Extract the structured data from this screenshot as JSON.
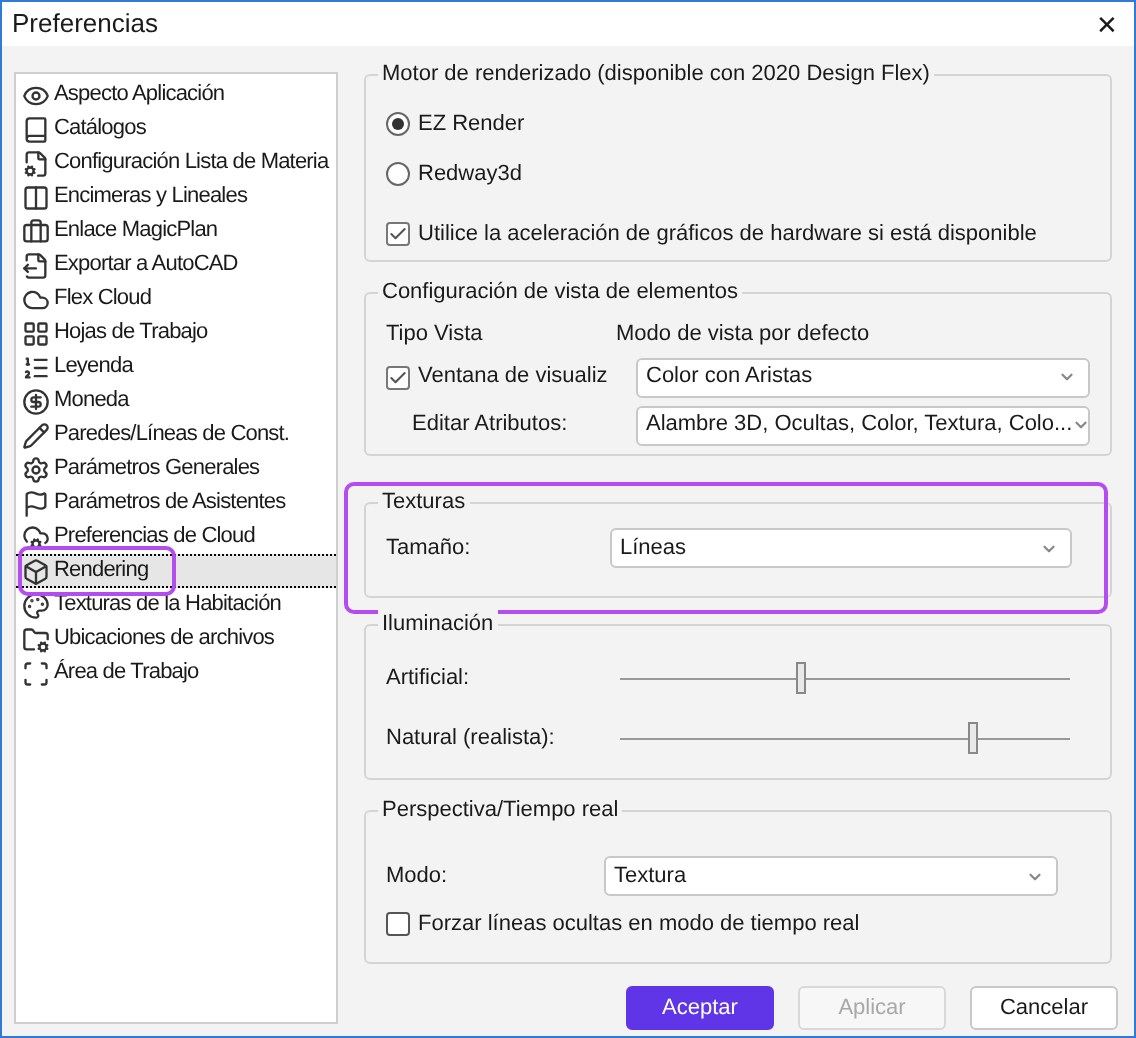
{
  "window": {
    "title": "Preferencias",
    "close": "✕"
  },
  "sidebar": {
    "items": [
      {
        "label": "Aspecto Aplicación",
        "selected": false
      },
      {
        "label": "Catálogos",
        "selected": false
      },
      {
        "label": "Configuración Lista de Materia",
        "selected": false
      },
      {
        "label": "Encimeras y Lineales",
        "selected": false
      },
      {
        "label": "Enlace MagicPlan",
        "selected": false
      },
      {
        "label": "Exportar a AutoCAD",
        "selected": false
      },
      {
        "label": "Flex Cloud",
        "selected": false
      },
      {
        "label": "Hojas de Trabajo",
        "selected": false
      },
      {
        "label": "Leyenda",
        "selected": false
      },
      {
        "label": "Moneda",
        "selected": false
      },
      {
        "label": "Paredes/Líneas de Const.",
        "selected": false
      },
      {
        "label": "Parámetros Generales",
        "selected": false
      },
      {
        "label": "Parámetros de Asistentes",
        "selected": false
      },
      {
        "label": "Preferencias de Cloud",
        "selected": false
      },
      {
        "label": "Rendering",
        "selected": true
      },
      {
        "label": "Texturas de la Habitación",
        "selected": false
      },
      {
        "label": "Ubicaciones de archivos",
        "selected": false
      },
      {
        "label": "Área de Trabajo",
        "selected": false
      }
    ]
  },
  "motor": {
    "title": "Motor de renderizado (disponible con 2020 Design Flex)",
    "options": [
      {
        "label": "EZ Render",
        "selected": true
      },
      {
        "label": "Redway3d",
        "selected": false
      }
    ],
    "hardware": {
      "label": "Utilice la aceleración de gráficos de hardware si está disponible",
      "checked": true
    }
  },
  "vista": {
    "title": "Configuración de vista de elementos",
    "col_1": "Tipo Vista",
    "col_2": "Modo de vista por defecto",
    "ventana": {
      "label": "Ventana de visualiz",
      "checked": true,
      "value": "Color con Aristas"
    },
    "editar": {
      "label": "Editar Atributos:",
      "value": "Alambre 3D, Ocultas, Color, Textura, Colo..."
    }
  },
  "texturas": {
    "title": "Texturas",
    "label": "Tamaño:",
    "value": "Líneas"
  },
  "iluminacion": {
    "title": "Iluminación",
    "sliders": [
      {
        "label": "Artificial:",
        "level": 0.4
      },
      {
        "label": "Natural (realista):",
        "level": 0.78
      }
    ]
  },
  "perspectiva": {
    "title": "Perspectiva/Tiempo real",
    "label": "Modo:",
    "value": "Textura",
    "forzar": {
      "label": "Forzar líneas ocultas en modo de tiempo real",
      "checked": false
    }
  },
  "buttons": [
    {
      "label": "Aceptar",
      "kind": "primary"
    },
    {
      "label": "Aplicar",
      "kind": "disabled"
    },
    {
      "label": "Cancelar",
      "kind": "normal"
    }
  ]
}
